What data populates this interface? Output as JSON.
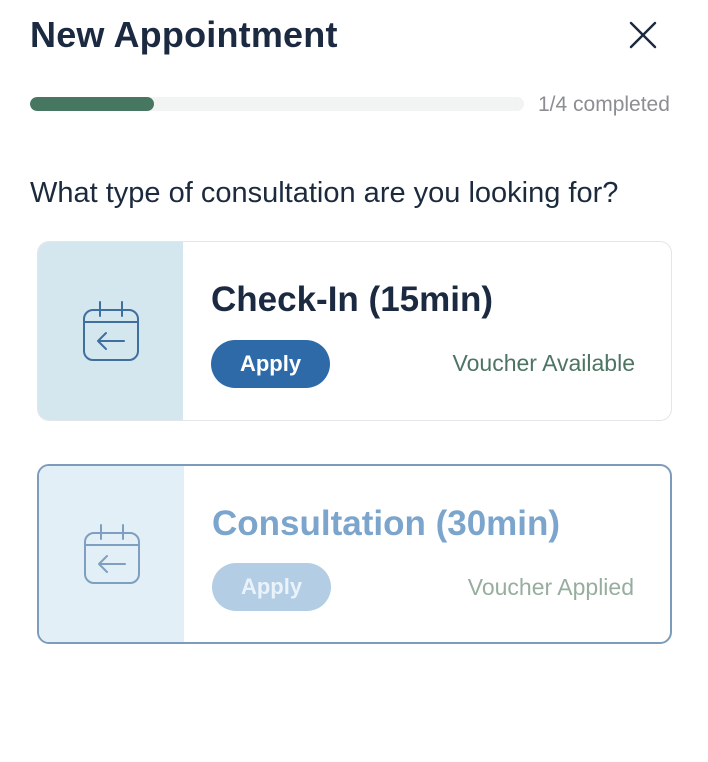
{
  "header": {
    "title": "New Appointment",
    "close_icon": "close-icon"
  },
  "progress": {
    "fraction": 0.25,
    "label": "1/4 completed",
    "fill_color": "#477760"
  },
  "question": "What type of consultation are you looking for?",
  "cards": [
    {
      "icon": "calendar-arrow-icon",
      "title": "Check-In (15min)",
      "button_label": "Apply",
      "status": "Voucher Available",
      "state": "default"
    },
    {
      "icon": "calendar-arrow-icon",
      "title": "Consultation (30min)",
      "button_label": "Apply",
      "status": "Voucher Applied",
      "state": "selected"
    }
  ],
  "colors": {
    "primary_blue": "#2f6aa8",
    "green_accent": "#4e7463",
    "selected_border": "#7d9cbb"
  }
}
